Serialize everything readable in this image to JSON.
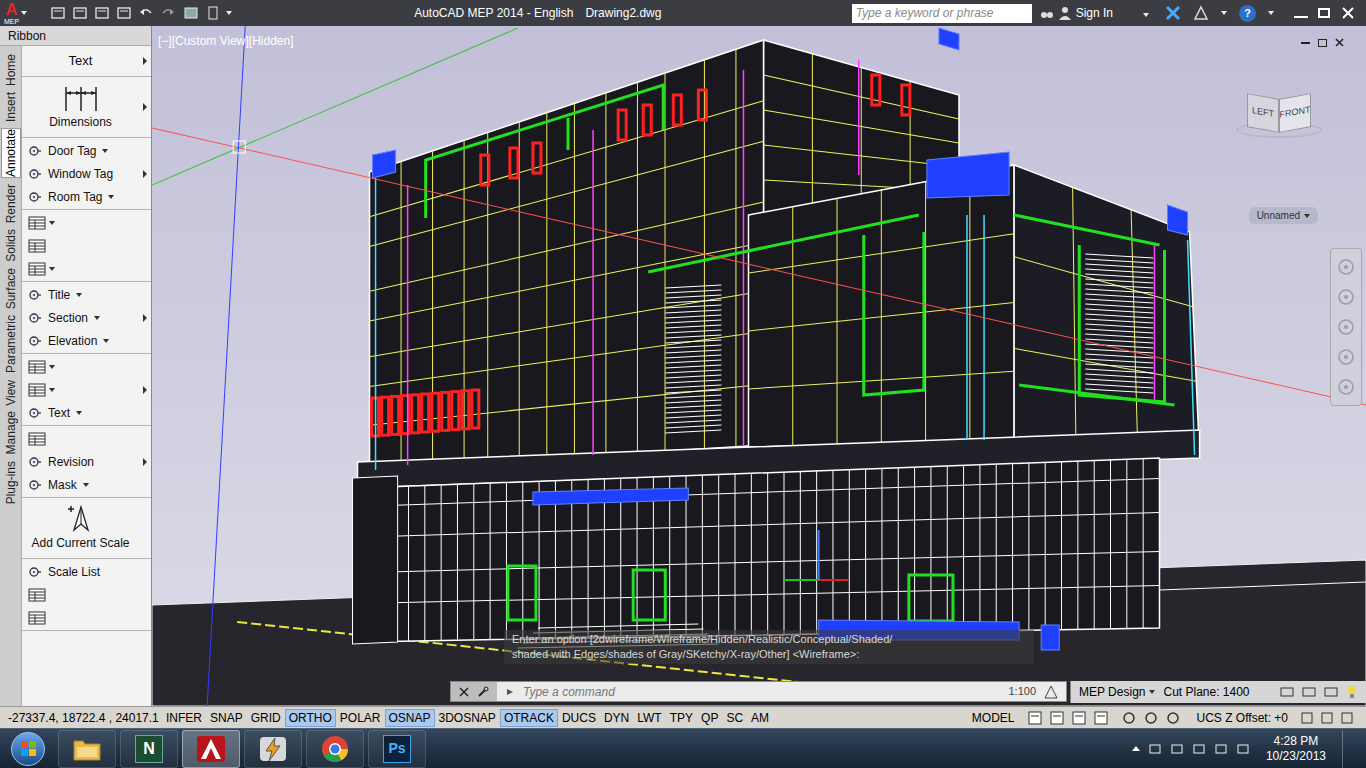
{
  "title_bar": {
    "logo": "A",
    "logo_sub": "MEP",
    "app_title": "AutoCAD MEP 2014 - English",
    "file_name": "Drawing2.dwg",
    "search_placeholder": "Type a keyword or phrase",
    "sign_in": "Sign In",
    "help": "?"
  },
  "ribbon": {
    "title": "Ribbon",
    "tabs": [
      {
        "label": "Home",
        "selected": false
      },
      {
        "label": "Insert",
        "selected": false
      },
      {
        "label": "Annotate",
        "selected": true
      },
      {
        "label": "Render",
        "selected": false
      },
      {
        "label": "Solids",
        "selected": false
      },
      {
        "label": "Surface",
        "selected": false
      },
      {
        "label": "Parametric",
        "selected": false
      },
      {
        "label": "View",
        "selected": false
      },
      {
        "label": "Manage",
        "selected": false
      },
      {
        "label": "Plug-ins",
        "selected": false
      }
    ],
    "groups": [
      {
        "expand": true,
        "items": [
          {
            "kind": "header",
            "label": "Text"
          }
        ]
      },
      {
        "expand": true,
        "items": [
          {
            "kind": "large",
            "label": "Dimensions"
          }
        ]
      },
      {
        "expand": true,
        "items": [
          {
            "kind": "row",
            "label": "Door Tag",
            "dropdown": true
          },
          {
            "kind": "row",
            "label": "Window Tag",
            "dropdown": false
          },
          {
            "kind": "row",
            "label": "Room Tag",
            "dropdown": true
          }
        ]
      },
      {
        "expand": false,
        "items": [
          {
            "kind": "icon",
            "dropdown": true
          },
          {
            "kind": "icon",
            "dropdown": false
          },
          {
            "kind": "icon",
            "dropdown": true
          }
        ]
      },
      {
        "expand": true,
        "items": [
          {
            "kind": "row",
            "label": "Title",
            "dropdown": true
          },
          {
            "kind": "row",
            "label": "Section",
            "dropdown": true
          },
          {
            "kind": "row",
            "label": "Elevation",
            "dropdown": true
          }
        ]
      },
      {
        "expand": true,
        "items": [
          {
            "kind": "icon",
            "dropdown": true
          },
          {
            "kind": "icon",
            "dropdown": true
          },
          {
            "kind": "row",
            "label": "Text",
            "dropdown": true
          }
        ]
      },
      {
        "expand": true,
        "items": [
          {
            "kind": "icon",
            "dropdown": false
          },
          {
            "kind": "row",
            "label": "Revision",
            "dropdown": false
          },
          {
            "kind": "row",
            "label": "Mask",
            "dropdown": true
          }
        ]
      },
      {
        "expand": false,
        "items": [
          {
            "kind": "large",
            "label": "Add Current Scale"
          }
        ]
      },
      {
        "expand": false,
        "items": [
          {
            "kind": "row",
            "label": "Scale List",
            "dropdown": false
          },
          {
            "kind": "icon",
            "dropdown": false
          },
          {
            "kind": "icon",
            "dropdown": false
          }
        ]
      }
    ]
  },
  "viewport": {
    "label": "[−][Custom View][Hidden]",
    "viewcube": {
      "left": "LEFT",
      "front": "FRONT"
    },
    "named_view": "Unnamed"
  },
  "command_line": {
    "history": [
      "Enter an option [2dwireframe/Wireframe/Hidden/Realistic/Conceptual/Shaded/",
      "shaded with Edges/shades of Gray/SKetchy/X-ray/Other] <Wireframe>:"
    ],
    "placeholder": "Type a command",
    "annotation_scale": "1:100"
  },
  "workspace_bar": {
    "workspace": "MEP Design",
    "cut_plane": "Cut Plane: 1400"
  },
  "status_bar": {
    "coordinates": "-27337.4, 18722.4 , 24017.1",
    "toggles": [
      {
        "label": "INFER",
        "on": false
      },
      {
        "label": "SNAP",
        "on": false
      },
      {
        "label": "GRID",
        "on": false
      },
      {
        "label": "ORTHO",
        "on": true
      },
      {
        "label": "POLAR",
        "on": false
      },
      {
        "label": "OSNAP",
        "on": true
      },
      {
        "label": "3DOSNAP",
        "on": false
      },
      {
        "label": "OTRACK",
        "on": true
      },
      {
        "label": "DUCS",
        "on": false
      },
      {
        "label": "DYN",
        "on": false
      },
      {
        "label": "LWT",
        "on": false
      },
      {
        "label": "TPY",
        "on": false
      },
      {
        "label": "QP",
        "on": false
      },
      {
        "label": "SC",
        "on": false
      },
      {
        "label": "AM",
        "on": false
      }
    ],
    "space": "MODEL",
    "ucs_offset": "UCS Z Offset: +0"
  },
  "taskbar": {
    "apps": [
      {
        "kind": "folder",
        "active": false
      },
      {
        "kind": "navisworks",
        "label": "N",
        "active": false
      },
      {
        "kind": "autocad",
        "active": true
      },
      {
        "kind": "bolt",
        "active": false
      },
      {
        "kind": "chrome",
        "active": false
      },
      {
        "kind": "photoshop",
        "label": "Ps",
        "active": false
      }
    ],
    "time": "4:28 PM",
    "date": "10/23/2013"
  }
}
